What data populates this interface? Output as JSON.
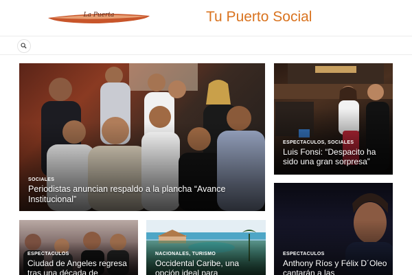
{
  "header": {
    "logo_text": "La Puerta",
    "site_title": "Tu Puerto Social"
  },
  "nav": {
    "search_icon": "search-icon"
  },
  "colors": {
    "title": "#d9731f",
    "overlay_text": "#ffffff"
  },
  "articles": [
    {
      "category": "SOCIALES",
      "title": "Periodistas anuncian respaldo a la plancha “Avance Institucional”"
    },
    {
      "category": "ESPECTACULOS, SOCIALES",
      "title": "Luis Fonsi: “Despacito ha sido una gran sorpresa”"
    },
    {
      "category": "ESPECTACULOS",
      "title": "Anthony Ríos y Félix D´Oleo cantarán a las"
    },
    {
      "category": "ESPECTACULOS",
      "title": "Ciudad de Angeles regresa tras una década de"
    },
    {
      "category": "NACIONALES, TURISMO",
      "title": "Occidental Caribe, una opción ideal para"
    }
  ]
}
